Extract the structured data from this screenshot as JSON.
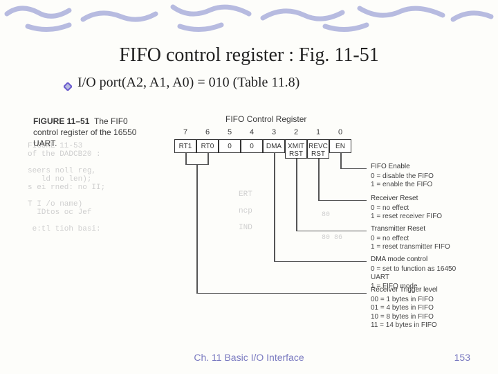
{
  "title": "FIFO control register : Fig. 11-51",
  "bullet": "I/O port(A2, A1, A0) = 010 (Table 11.8)",
  "caption": {
    "bold": "FIGURE 11–51",
    "rest": "The FIF0 control register of the 16550 UART."
  },
  "register_title": "FIFO Control Register",
  "bits": {
    "numbers": [
      "7",
      "6",
      "5",
      "4",
      "3",
      "2",
      "1",
      "0"
    ],
    "labels": [
      "RT1",
      "RT0",
      "0",
      "0",
      "DMA",
      [
        "XMIT",
        "RST"
      ],
      [
        "REVC",
        "RST"
      ],
      "EN"
    ]
  },
  "descs": [
    {
      "head": "FIFO Enable",
      "lines": [
        "0 = disable the FIFO",
        "1 = enable the FIFO"
      ]
    },
    {
      "head": "Receiver Reset",
      "lines": [
        "0 = no effect",
        "1 = reset receiver FIFO"
      ]
    },
    {
      "head": "Transmitter Reset",
      "lines": [
        "0 = no effect",
        "1 = reset transmitter FIFO"
      ]
    },
    {
      "head": "DMA mode control",
      "lines": [
        "0 = set to function as 16450 UART",
        "1 = FIFO mode"
      ]
    },
    {
      "head": "Receiver Trigger level",
      "lines": [
        "00 = 1 bytes in FIFO",
        "01 = 4 bytes in FIFO",
        "10 = 8 bytes in FIFO",
        "11 = 14 bytes in FIFO"
      ]
    }
  ],
  "bg": [
    "FIGURE 11-53",
    "of the DADCB20 :",
    "",
    "seers noll reg,",
    "   ld no len);",
    "s ei rned: no II;",
    "",
    "T I /o name)",
    "  IDtos oc Jef",
    "",
    " e:tl tioh basi:"
  ],
  "bg2": [
    "ERT",
    "ncp",
    "IND"
  ],
  "bg3": [
    "80",
    "80 86"
  ],
  "footer": {
    "chapter": "Ch. 11 Basic I/O Interface",
    "page": "153"
  }
}
